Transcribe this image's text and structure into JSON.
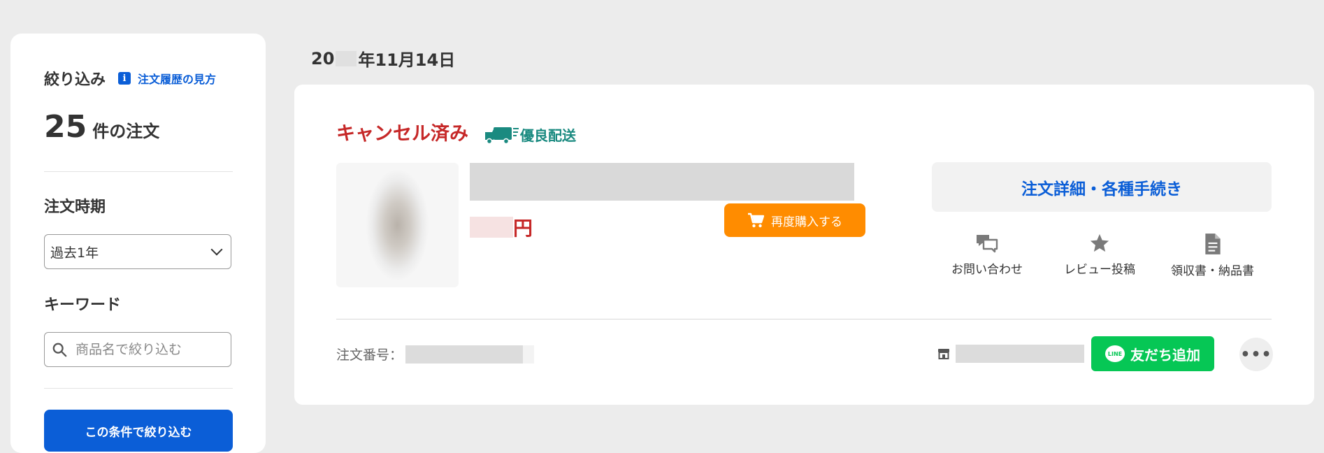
{
  "sidebar": {
    "title": "絞り込み",
    "help_link": "注文履歴の見方",
    "order_count": "25",
    "order_count_suffix": "件の注文",
    "period_label": "注文時期",
    "period_value": "過去1年",
    "keyword_label": "キーワード",
    "keyword_placeholder": "商品名で絞り込む",
    "apply_button": "この条件で絞り込む"
  },
  "order": {
    "date_prefix": "20",
    "date_suffix": "年11月14日",
    "status": "キャンセル済み",
    "shipping_badge": "優良配送",
    "price_unit": "円",
    "rebuy_button": "再度購入する",
    "detail_button": "注文詳細・各種手続き",
    "actions": [
      {
        "label": "お問い合わせ",
        "icon": "chat-icon"
      },
      {
        "label": "レビュー投稿",
        "icon": "star-icon"
      },
      {
        "label": "領収書・納品書",
        "icon": "document-icon"
      }
    ],
    "order_number_label": "注文番号：",
    "line_button": "友だち追加",
    "line_logo_text": "LINE"
  },
  "colors": {
    "accent_blue": "#0b5ed7",
    "status_red": "#c62828",
    "rebuy_orange": "#ff8c00",
    "line_green": "#06c755",
    "badge_teal": "#1a8a80"
  }
}
